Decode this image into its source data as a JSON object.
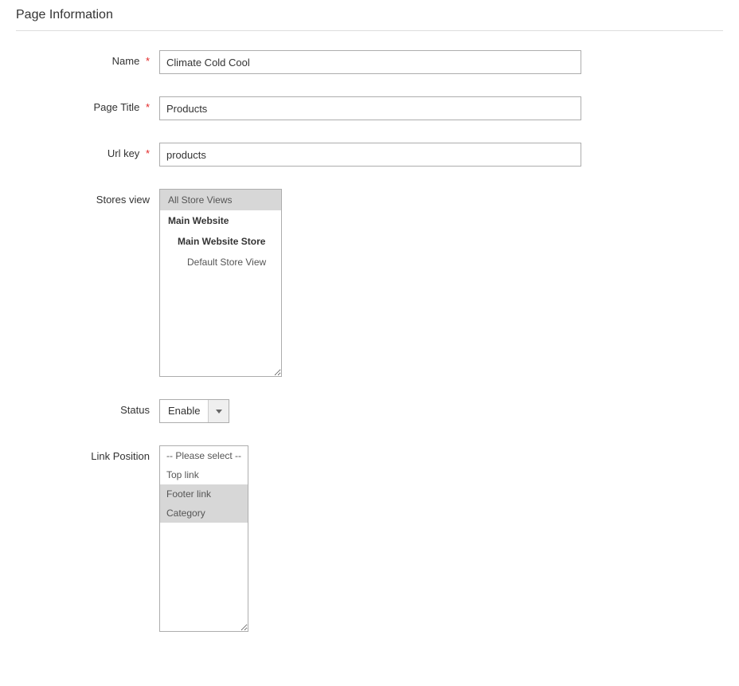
{
  "section": {
    "title": "Page Information"
  },
  "fields": {
    "name": {
      "label": "Name",
      "required": true,
      "value": "Climate Cold Cool"
    },
    "pageTitle": {
      "label": "Page Title",
      "required": true,
      "value": "Products"
    },
    "urlKey": {
      "label": "Url key",
      "required": true,
      "value": "products"
    },
    "storesView": {
      "label": "Stores view",
      "options": [
        {
          "label": "All Store Views",
          "level": 0,
          "selected": true
        },
        {
          "label": "Main Website",
          "level": 1,
          "selected": false
        },
        {
          "label": "Main Website Store",
          "level": 2,
          "selected": false
        },
        {
          "label": "Default Store View",
          "level": 3,
          "selected": false
        }
      ]
    },
    "status": {
      "label": "Status",
      "value": "Enable"
    },
    "linkPosition": {
      "label": "Link Position",
      "options": [
        {
          "label": "-- Please select --",
          "selected": false
        },
        {
          "label": "Top link",
          "selected": false
        },
        {
          "label": "Footer link",
          "selected": true
        },
        {
          "label": "Category",
          "selected": true
        }
      ]
    }
  }
}
